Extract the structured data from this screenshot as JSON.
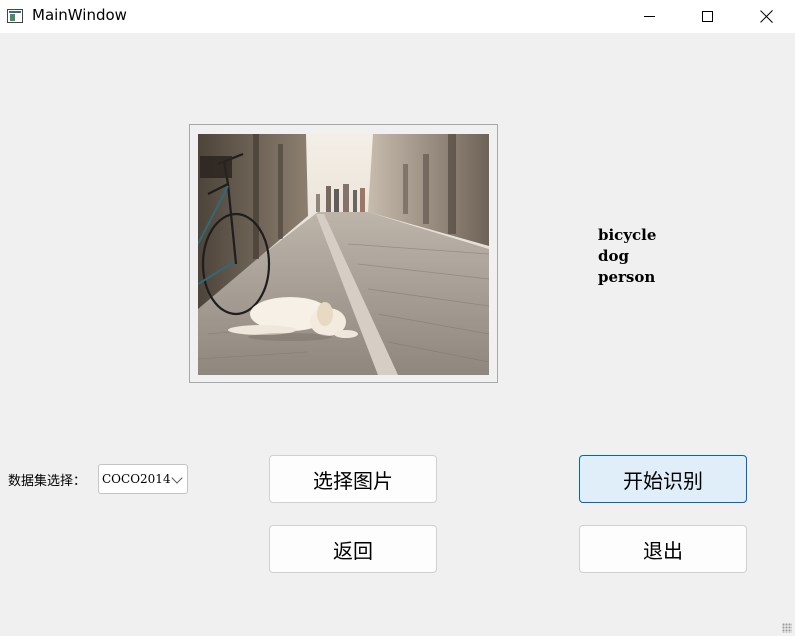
{
  "window": {
    "title": "MainWindow",
    "icons": {
      "app": "app-window-icon",
      "minimize": "minimize-icon",
      "maximize": "maximize-icon",
      "close": "close-icon"
    }
  },
  "image_panel": {
    "description_icon": "photo-street-dog-bicycle"
  },
  "results": {
    "labels": [
      "bicycle",
      "dog",
      "person"
    ]
  },
  "dataset": {
    "label": "数据集选择：",
    "selected": "COCO2014"
  },
  "buttons": {
    "select_image": "选择图片",
    "start": "开始识别",
    "back": "返回",
    "exit": "退出"
  },
  "colors": {
    "window_bg": "#f0f0f0",
    "primary_button_bg": "#e0eef9",
    "primary_button_border": "#0067c0"
  }
}
